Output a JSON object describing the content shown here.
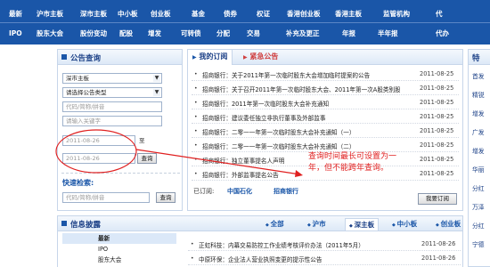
{
  "nav": {
    "row1": [
      "最新",
      "沪市主板",
      "深市主板",
      "中小板",
      "创业板",
      "基金",
      "债券",
      "权证",
      "香港创业板",
      "香港主板",
      "监管机构",
      "代"
    ],
    "row2": [
      "IPO",
      "股东大会",
      "股份变动",
      "配股",
      "增发",
      "可转债",
      "分配",
      "交易",
      "补充及更正",
      "年报",
      "半年报",
      "代办"
    ]
  },
  "query": {
    "title": "公告查询",
    "market_select": "深市主板",
    "type_select": "请选择公告类型",
    "code_placeholder": "代码/简称/拼音",
    "keyword_placeholder": "请输入关键字",
    "start_date": "2011-08-26",
    "to_label": "至",
    "end_date": "2011-08-26",
    "query_button": "查询",
    "quick_search_title": "快速检索:",
    "quick_placeholder": "代码/简称/拼音",
    "quick_button": "查询"
  },
  "subscription": {
    "tab_active": "我的订阅",
    "tab_other": "紧急公告",
    "items": [
      {
        "title": "招商银行：关于2011年第一次临时股东大会增加临时提案的公告",
        "date": "2011-08-25"
      },
      {
        "title": "招商银行：关于召开2011年第一次临时股东大会、2011年第一次A股类别股东会议的补充通知",
        "date": "2011-08-25"
      },
      {
        "title": "招商银行：2011年第一次临时股东大会补充通知",
        "date": "2011-08-25"
      },
      {
        "title": "招商银行：建议委任独立非执行董事及外部监事",
        "date": "2011-08-25"
      },
      {
        "title": "招商银行：二零一一年第一次临时股东大会补充通知（一）",
        "date": "2011-08-25"
      },
      {
        "title": "招商银行：二零一一年第一次临时股东大会补充通知（二）",
        "date": "2011-08-25"
      },
      {
        "title": "招商银行：独立董事提名人声明",
        "date": "2011-08-25"
      },
      {
        "title": "招商银行：外部监事提名公告",
        "date": "2011-08-25"
      }
    ],
    "subscribed_label": "已订阅:",
    "subscribed": [
      "中国石化",
      "招商银行"
    ],
    "my_sub_button": "我要订阅"
  },
  "annotation": {
    "text": "查询时间最长可设置为一年，但不能跨年查询。"
  },
  "right_panel": {
    "title": "特",
    "items": [
      "首发",
      "精锐",
      "增发",
      "广发",
      "增发",
      "华丽",
      "分红",
      "万泽",
      "分红",
      "宁德"
    ]
  },
  "info": {
    "title": "信息披露",
    "tabs": [
      "全部",
      "沪市",
      "深主板",
      "中小板",
      "创业板"
    ],
    "active_tab": "深主板",
    "left_items": [
      "最新",
      "IPO",
      "股东大会"
    ],
    "rows": [
      {
        "title": "正虹科技：内幕交易防控工作业绩考核评价办法（2011年5月）",
        "date": "2011-08-26"
      },
      {
        "title": "中原环保：企业法人营业执照变更的提示性公告",
        "date": "2011-08-26"
      }
    ]
  },
  "colors": {
    "nav_blue": "#1a56a8",
    "title_blue": "#1a3f86",
    "annotation_red": "#e02020",
    "urgent_red": "#d04040"
  }
}
